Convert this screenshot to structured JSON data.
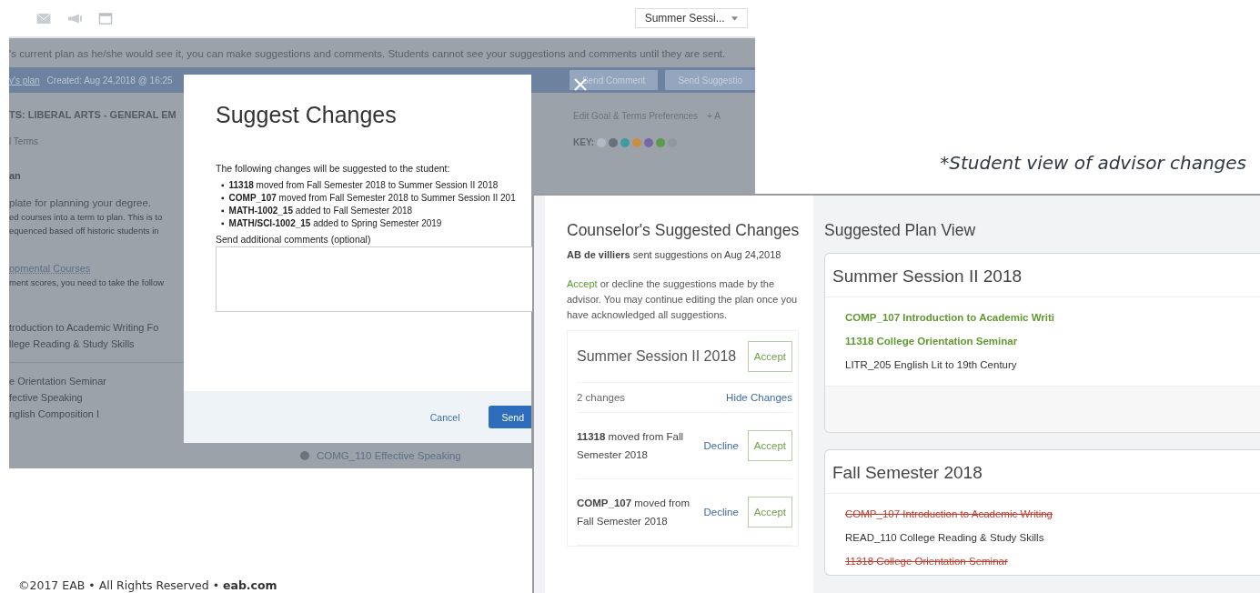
{
  "advisor_screen": {
    "term_dropdown": "Summer Sessi...",
    "info_text": "'s current plan as he/she would see it, you can make suggestions and comments. Students cannot see your suggestions and comments until they are sent.",
    "plan_link": "y's plan",
    "created": "Created: Aug 24,2018 @ 16:25",
    "buttons": [
      "Send Comment",
      "Send Suggestio"
    ],
    "program_heading": "TS: LIBERAL ARTS - GENERAL EM",
    "edit_link": "Edit Goal & Terms Preferences",
    "add_link": "+ A",
    "terms_label": "l Terms",
    "key": {
      "label": "KEY:",
      "dots": [
        {
          "color": "#b4bac1"
        },
        {
          "color": "#66717d"
        },
        {
          "color": "#3f9aa2"
        },
        {
          "color": "#c98f3c"
        },
        {
          "color": "#7766a8"
        },
        {
          "color": "#5c9a4c"
        },
        {
          "color": "#8f98a2"
        }
      ]
    },
    "left_column": [
      {
        "kind": "heading",
        "text": "an"
      },
      {
        "kind": "lead",
        "text": "plate for planning your degree."
      },
      {
        "kind": "note",
        "text": "ed courses into a term to plan. This is to"
      },
      {
        "kind": "note",
        "text": "equenced based off historic students in"
      },
      {
        "kind": "link",
        "text": "opmental Courses"
      },
      {
        "kind": "note",
        "text": "ment scores, you need to take the follow"
      },
      {
        "kind": "course",
        "text": "troduction to Academic Writing Fo"
      },
      {
        "kind": "course",
        "text": "llege Reading & Study Skills"
      },
      {
        "kind": "divider",
        "text": "e Orientation Seminar"
      },
      {
        "kind": "course",
        "text": "fective Speaking"
      },
      {
        "kind": "course",
        "text": "nglish Composition I"
      }
    ],
    "course_row": "COMG_110 Effective Speaking"
  },
  "modal": {
    "title": "Suggest Changes",
    "intro": "The following changes will be suggested to the student:",
    "bullet": "▪",
    "changes": [
      "**11318** moved from Fall Semester 2018 to Summer Session II 2018",
      "**COMP_107** moved from Fall Semester 2018 to Summer Session II 201",
      "**MATH-1002_15** added to Fall Semester 2018",
      "**MATH/SCI-1002_15** added to Spring Semester 2019"
    ],
    "comments_label": "Send additional comments (optional)",
    "cancel": "Cancel",
    "send": "Send"
  },
  "caption": "*Student view of advisor changes",
  "student_view": {
    "title": "Counselor's Suggested Changes",
    "sender_line": "**AB de villiers** sent suggestions on Aug 24,2018",
    "instruction": {
      "accent": "Accept",
      "rest": " or decline the suggestions made by the advisor. You may continue editing the plan once you have acknowledged all suggestions."
    },
    "term_card": {
      "term": "Summer Session II 2018",
      "accept": "Accept",
      "count": "2 changes",
      "toggle": "Hide Changes",
      "changes": [
        {
          "text": "**11318** moved from Fall Semester 2018",
          "decline": "Decline",
          "accept": "Accept"
        },
        {
          "text": "**COMP_107** moved from Fall Semester 2018",
          "decline": "Decline",
          "accept": "Accept"
        }
      ]
    },
    "plan_title": "Suggested Plan View",
    "plan_terms": [
      {
        "term": "Summer Session II 2018",
        "courses": [
          {
            "text": "COMP_107 Introduction to Academic Writi",
            "kind": "added"
          },
          {
            "text": "11318 College Orientation Seminar",
            "kind": "added"
          },
          {
            "text": "LITR_205 English Lit to 19th Century",
            "kind": "unchanged"
          }
        ]
      },
      {
        "term": "Fall Semester 2018",
        "courses": [
          {
            "text": "COMP_107 Introduction to Academic Writing",
            "kind": "removed"
          },
          {
            "text": "READ_110 College Reading & Study Skills",
            "kind": "unchanged"
          },
          {
            "text": "11318 College Orientation Seminar",
            "kind": "removed"
          }
        ]
      }
    ]
  },
  "footer": "©2017 EAB • All Rights Reserved • **eab.com**"
}
